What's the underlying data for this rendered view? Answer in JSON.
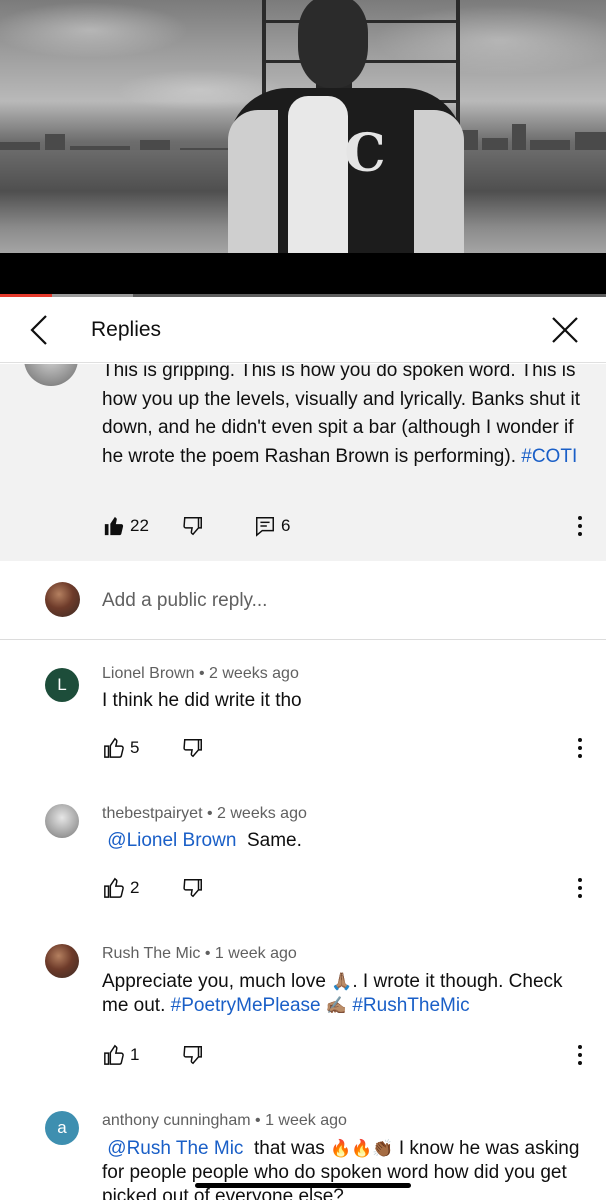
{
  "video": {
    "jacket_letter": "C",
    "progress_fraction": 0.085,
    "buffer_fraction": 0.22
  },
  "header": {
    "title": "Replies",
    "back_icon": "chevron-left-icon",
    "close_icon": "close-icon"
  },
  "parent_comment": {
    "text": "This is gripping. This is how you do spoken word. This is how you up the levels, visually and lyrically.  Banks shut it down, and he didn't even spit a bar (although I wonder if he wrote the poem Rashan Brown is performing).",
    "hashtag": "#COTI",
    "likes": "22",
    "replies_count": "6",
    "icons": [
      "thumb-up-filled-icon",
      "thumb-down-icon",
      "reply-icon",
      "more-vert-icon"
    ]
  },
  "add_reply": {
    "placeholder": "Add a public reply..."
  },
  "replies": [
    {
      "author": "Lionel Brown",
      "time": "2 weeks ago",
      "avatar_letter": "L",
      "avatar_color": "#1d4d3a",
      "text": "I think he did write it tho",
      "likes": "5"
    },
    {
      "author": "thebestpairyet",
      "time": "2 weeks ago",
      "mention": "@Lionel Brown",
      "text": "Same.",
      "likes": "2"
    },
    {
      "author": "Rush The Mic",
      "time": "1 week ago",
      "text_a": "Appreciate you, much love",
      "emoji_a": "🙏🏽",
      "text_b": ". I wrote it though. Check me out.",
      "hashtag_1": "#PoetryMePlease",
      "emoji_b": "✍🏽",
      "hashtag_2": "#RushTheMic",
      "likes": "1"
    },
    {
      "author": "anthony cunningham",
      "time": "1 week ago",
      "avatar_letter": "a",
      "avatar_color": "#3e8fb0",
      "mention": "@Rush The Mic",
      "text_a": "that was",
      "emoji_a": "🔥🔥👏🏾",
      "text_b": "I know he was asking for people people who do spoken word how did you get picked out of everyone else?"
    }
  ],
  "separator": "•"
}
